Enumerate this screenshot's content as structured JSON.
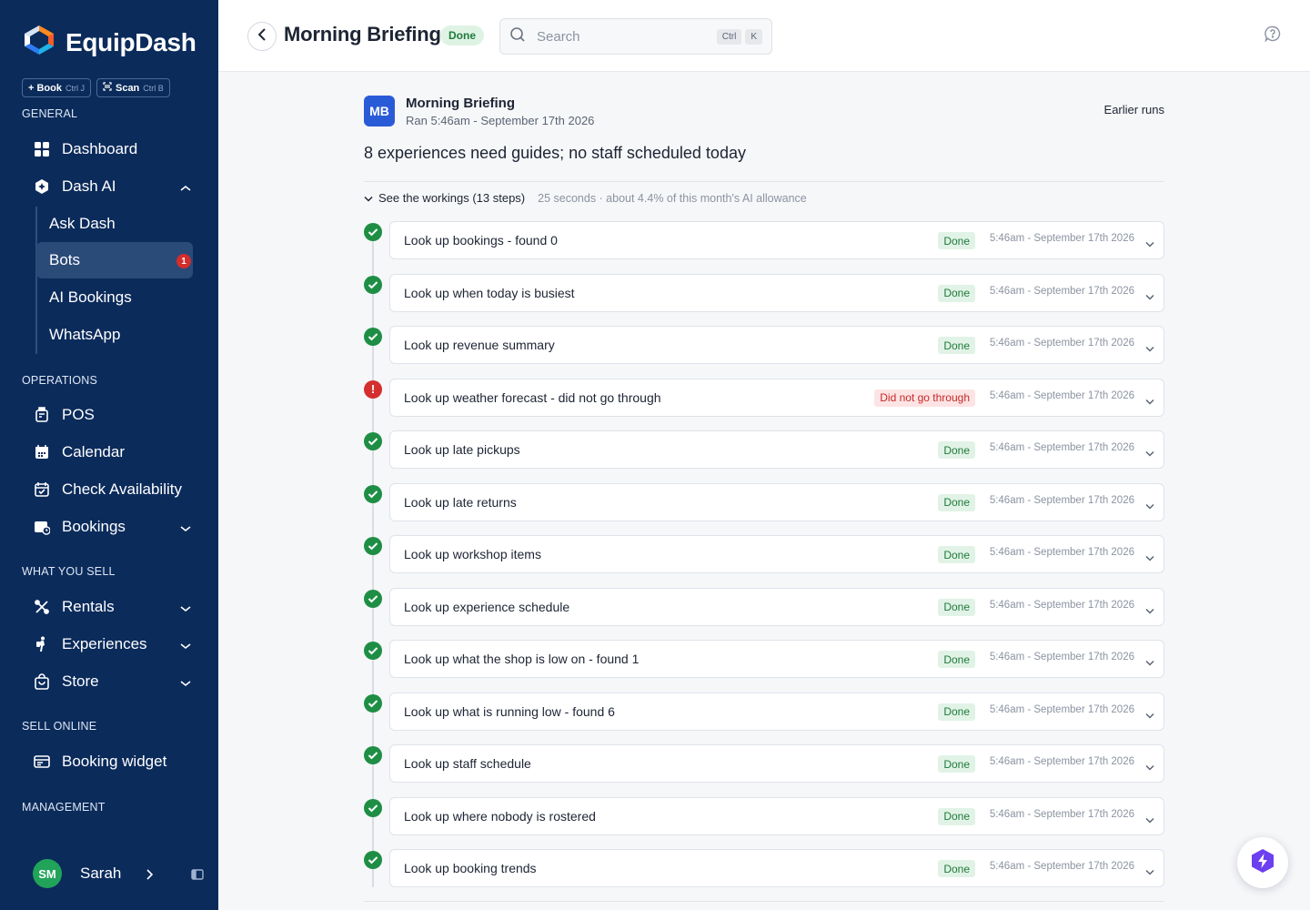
{
  "app": {
    "name": "EquipDash"
  },
  "quick_actions": [
    {
      "label": "+ Book",
      "shortcut": "Ctrl J"
    },
    {
      "label": "Scan",
      "shortcut": "Ctrl B"
    }
  ],
  "sidebar": {
    "sections": [
      "GENERAL",
      "OPERATIONS",
      "WHAT YOU SELL",
      "SELL ONLINE",
      "MANAGEMENT"
    ],
    "items": {
      "dashboard": "Dashboard",
      "dash_ai": "Dash AI",
      "ask_dash": "Ask Dash",
      "bots": "Bots",
      "bots_count": "1",
      "ai_bookings": "AI Bookings",
      "whatsapp": "WhatsApp",
      "pos": "POS",
      "calendar": "Calendar",
      "check_availability": "Check Availability",
      "bookings": "Bookings",
      "rentals": "Rentals",
      "experiences": "Experiences",
      "store": "Store",
      "booking_widget": "Booking widget"
    },
    "user": {
      "initials": "SM",
      "name": "Sarah"
    }
  },
  "header": {
    "title": "Morning Briefing",
    "status": "Done",
    "search_placeholder": "Search",
    "search_keys": [
      "Ctrl",
      "K"
    ]
  },
  "run": {
    "avatar": "MB",
    "name": "Morning Briefing",
    "ran": "Ran 5:46am - September 17th 2026",
    "earlier_runs": "Earlier runs",
    "summary": "8 experiences need guides; no staff scheduled today",
    "workings_label": "See the workings (13 steps)",
    "workings_meta": "25 seconds · about 4.4% of this month's AI allowance"
  },
  "steps": [
    {
      "label": "Look up bookings - found 0",
      "status": "Done",
      "time": "5:46am - September 17th 2026"
    },
    {
      "label": "Look up when today is busiest",
      "status": "Done",
      "time": "5:46am - September 17th 2026"
    },
    {
      "label": "Look up revenue summary",
      "status": "Done",
      "time": "5:46am - September 17th 2026"
    },
    {
      "label": "Look up weather forecast - did not go through",
      "status": "Did not go through",
      "time": "5:46am - September 17th 2026"
    },
    {
      "label": "Look up late pickups",
      "status": "Done",
      "time": "5:46am - September 17th 2026"
    },
    {
      "label": "Look up late returns",
      "status": "Done",
      "time": "5:46am - September 17th 2026"
    },
    {
      "label": "Look up workshop items",
      "status": "Done",
      "time": "5:46am - September 17th 2026"
    },
    {
      "label": "Look up experience schedule",
      "status": "Done",
      "time": "5:46am - September 17th 2026"
    },
    {
      "label": "Look up what the shop is low on - found 1",
      "status": "Done",
      "time": "5:46am - September 17th 2026"
    },
    {
      "label": "Look up what is running low - found 6",
      "status": "Done",
      "time": "5:46am - September 17th 2026"
    },
    {
      "label": "Look up staff schedule",
      "status": "Done",
      "time": "5:46am - September 17th 2026"
    },
    {
      "label": "Look up where nobody is rostered",
      "status": "Done",
      "time": "5:46am - September 17th 2026"
    },
    {
      "label": "Look up booking trends",
      "status": "Done",
      "time": "5:46am - September 17th 2026"
    }
  ],
  "colors": {
    "sidebar": "#0b2b5b",
    "success": "#1e8e45",
    "error": "#d32f2f",
    "accent": "#2a5bd7"
  }
}
